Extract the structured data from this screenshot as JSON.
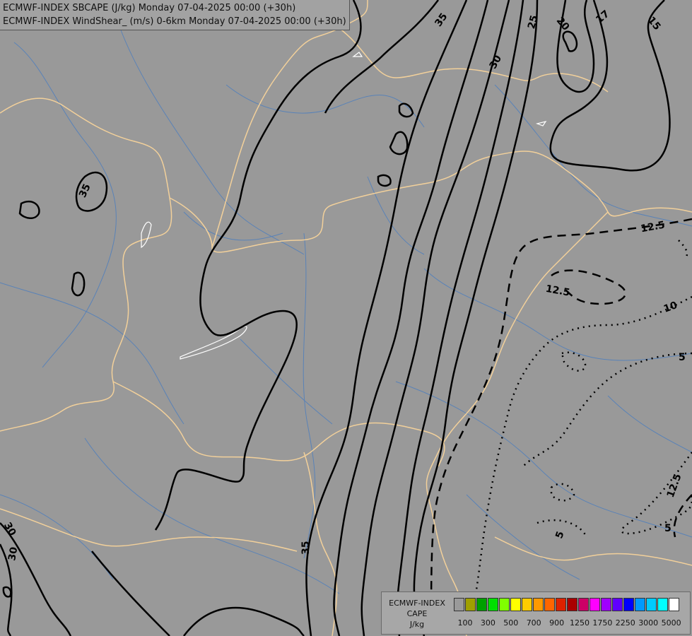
{
  "header": {
    "line1": "ECMWF-INDEX SBCAPE (J/kg) Monday 07-04-2025 00:00 (+30h)",
    "line2": "ECMWF-INDEX WindShear_ (m/s) 0-6km Monday 07-04-2025 00:00 (+30h)"
  },
  "legend": {
    "line1": "ECMWF-INDEX",
    "line2": "CAPE",
    "line3": "J/kg",
    "colors": [
      "#9a9a9a",
      "#a0a000",
      "#00a000",
      "#00e000",
      "#80ff00",
      "#ffff00",
      "#ffcc00",
      "#ff9900",
      "#ff6600",
      "#dd2200",
      "#aa0000",
      "#cc0066",
      "#ff00ff",
      "#a000ff",
      "#6000ff",
      "#0000ff",
      "#0099ff",
      "#00ccff",
      "#00ffff",
      "#ffffff"
    ],
    "tick_labels": [
      "100",
      "300",
      "500",
      "700",
      "900",
      "1250",
      "1750",
      "2250",
      "3000",
      "5000"
    ]
  },
  "contour_labels": [
    "35",
    "25",
    "20",
    "17",
    "15",
    "30",
    "35",
    "12.5",
    "12.5",
    "10",
    "5",
    "5",
    "12.5",
    "5",
    "30",
    "30",
    "35"
  ],
  "colors": {
    "background": "#999999",
    "borders": "#f2d09a",
    "rivers": "#4f7fbd",
    "lakes": "#ffffff",
    "contours": "#000000"
  }
}
